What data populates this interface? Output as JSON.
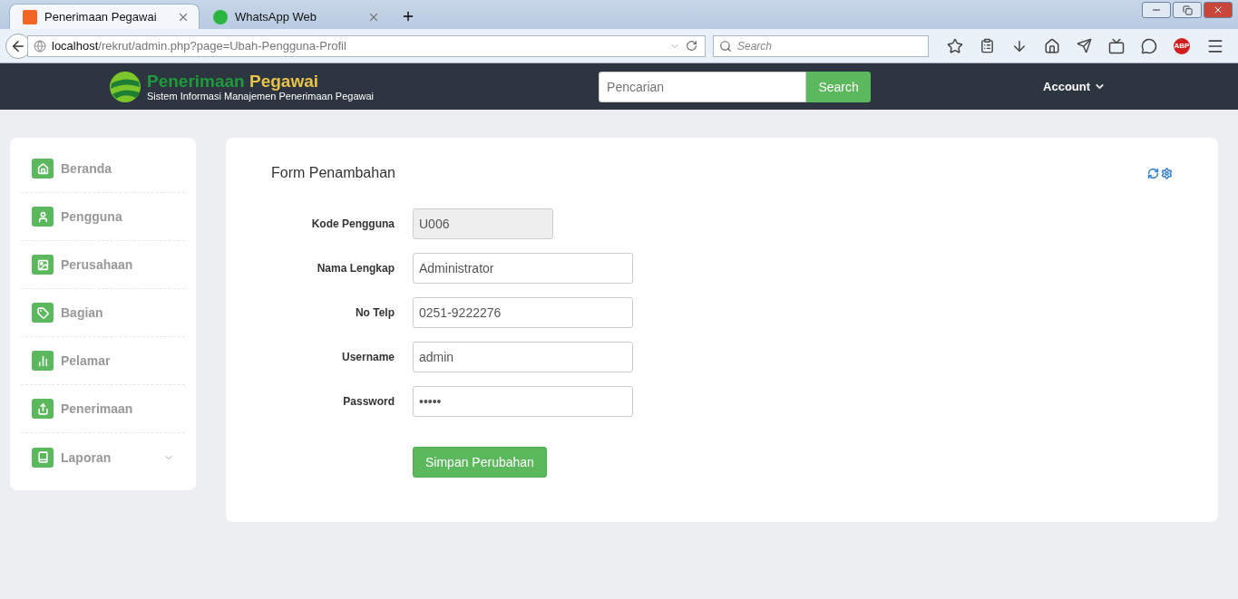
{
  "browser": {
    "tabs": [
      {
        "title": "Penerimaan Pegawai",
        "selected": true
      },
      {
        "title": "WhatsApp Web",
        "selected": false
      }
    ],
    "address": {
      "host": "localhost",
      "path": "/rekrut/admin.php?page=Ubah-Pengguna-Profil"
    },
    "search": {
      "placeholder": "Search"
    },
    "adblock_label": "ABP"
  },
  "header": {
    "brand_first": "Penerimaan",
    "brand_second": "Pegawai",
    "tagline": "Sistem Informasi Manajemen Penerimaan Pegawai",
    "search": {
      "placeholder": "Pencarian",
      "button": "Search"
    },
    "account": "Account"
  },
  "sidebar": {
    "items": [
      {
        "label": "Beranda",
        "has_submenu": false
      },
      {
        "label": "Pengguna",
        "has_submenu": false
      },
      {
        "label": "Perusahaan",
        "has_submenu": false
      },
      {
        "label": "Bagian",
        "has_submenu": false
      },
      {
        "label": "Pelamar",
        "has_submenu": false
      },
      {
        "label": "Penerimaan",
        "has_submenu": false
      },
      {
        "label": "Laporan",
        "has_submenu": true
      }
    ]
  },
  "form": {
    "title": "Form Penambahan",
    "fields": [
      {
        "label": "Kode Pengguna",
        "value": "U006",
        "kind": "readonly"
      },
      {
        "label": "Nama Lengkap",
        "value": "Administrator",
        "kind": "text"
      },
      {
        "label": "No Telp",
        "value": "0251-9222276",
        "kind": "text"
      },
      {
        "label": "Username",
        "value": "admin",
        "kind": "text"
      },
      {
        "label": "Password",
        "value": "•••••",
        "kind": "password"
      }
    ],
    "submit": "Simpan Perubahan"
  }
}
